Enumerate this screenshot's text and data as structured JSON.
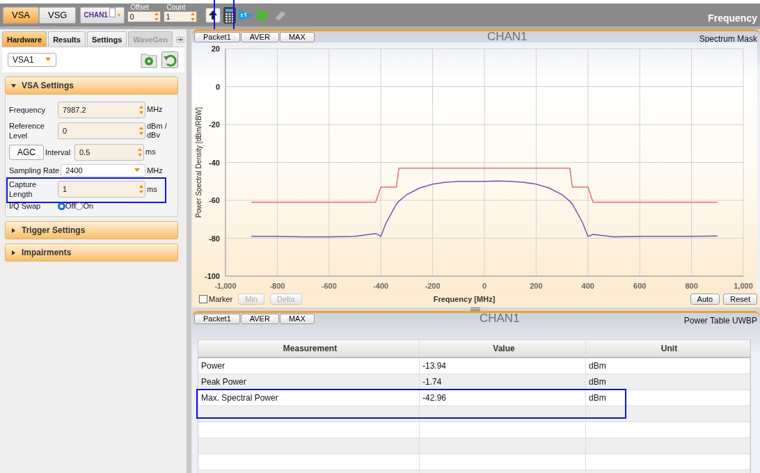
{
  "toolbar": {
    "modes": [
      {
        "label": "VSA",
        "selected": true
      },
      {
        "label": "VSG",
        "selected": false
      }
    ],
    "channel": "CHAN1",
    "spinners": [
      {
        "label": "Offset",
        "value": "0"
      },
      {
        "label": "Count",
        "value": "1"
      }
    ],
    "tools": [
      {
        "kind": "upload",
        "highlighted": false,
        "disabled": false
      },
      {
        "kind": "calculator",
        "highlighted": true,
        "disabled": false
      },
      {
        "kind": "run-once",
        "highlighted": false,
        "disabled": false
      },
      {
        "kind": "run",
        "highlighted": false,
        "disabled": false
      },
      {
        "kind": "eraser",
        "highlighted": false,
        "disabled": true
      }
    ],
    "title": "Frequency"
  },
  "sidebar": {
    "tabs": [
      {
        "label": "Hardware",
        "selected": true,
        "disabled": false
      },
      {
        "label": "Results",
        "selected": false,
        "disabled": false
      },
      {
        "label": "Settings",
        "selected": false,
        "disabled": false
      },
      {
        "label": "WaveGen",
        "selected": false,
        "disabled": true
      }
    ],
    "device": "VSA1",
    "sections": [
      {
        "title": "VSA Settings",
        "expanded": true,
        "fields": [
          {
            "kind": "spin",
            "label": "Frequency",
            "value": "7987.2",
            "unit": "MHz",
            "highlighted": false
          },
          {
            "kind": "spin",
            "label": "Reference Level",
            "value": "0",
            "unit": "dBm / dBv",
            "highlighted": false
          },
          {
            "kind": "agc",
            "button": "AGC",
            "label": "Interval",
            "value": "0.5",
            "unit": "ms",
            "highlighted": false
          },
          {
            "kind": "select",
            "label": "Sampling Rate",
            "value": "2400",
            "unit": "MHz",
            "highlighted": false
          },
          {
            "kind": "spin",
            "label": "Capture Length",
            "value": "1",
            "unit": "ms",
            "highlighted": true
          },
          {
            "kind": "radio",
            "label": "I/Q Swap",
            "options": [
              {
                "label": "Off",
                "selected": true
              },
              {
                "label": "On",
                "selected": false
              }
            ],
            "highlighted": false
          }
        ]
      },
      {
        "title": "Trigger Settings",
        "expanded": false
      },
      {
        "title": "Impairments",
        "expanded": false
      }
    ]
  },
  "spectrum_panel": {
    "views": [
      "Packet1",
      "AVER",
      "MAX"
    ],
    "channel": "CHAN1",
    "title": "Spectrum Mask",
    "chart_data": {
      "type": "line",
      "xlabel": "Frequency [MHz]",
      "ylabel": "Power Spectral Density [dBm/RBW]",
      "x": [
        -900,
        -800,
        -700,
        -600,
        -500,
        -420,
        -400,
        -380,
        -340,
        -330,
        -300,
        -250,
        -200,
        -150,
        -100,
        -50,
        0,
        50,
        100,
        150,
        200,
        250,
        300,
        330,
        340,
        380,
        400,
        420,
        500,
        600,
        700,
        800,
        900
      ],
      "series": [
        {
          "color": "#e07070",
          "values": [
            -61,
            -61,
            -61,
            -61,
            -61,
            -61,
            -53,
            -53,
            -53,
            -43,
            -43,
            -43,
            -43,
            -43,
            -43,
            -43,
            -43,
            -43,
            -43,
            -43,
            -43,
            -43,
            -43,
            -43,
            -53,
            -53,
            -53,
            -61,
            -61,
            -61,
            -61,
            -61,
            -61
          ]
        },
        {
          "color": "#7b4fb0",
          "values": [
            -79,
            -79,
            -79.3,
            -79.3,
            -79,
            -77.5,
            -79,
            -72,
            -62,
            -60.5,
            -57,
            -53.5,
            -51.5,
            -50.5,
            -50,
            -50,
            -50,
            -49.8,
            -50,
            -50.5,
            -51.5,
            -53.5,
            -57,
            -60.5,
            -62,
            -72,
            -79,
            -78,
            -79.3,
            -79,
            -79,
            -79,
            -78.8
          ]
        }
      ],
      "xlim": [
        -1000,
        1000
      ],
      "ylim": [
        -100,
        20
      ],
      "xticks": [
        {
          "value": -1000,
          "label": "-1,000"
        },
        -800,
        -600,
        -400,
        -200,
        0,
        200,
        400,
        600,
        800,
        {
          "value": 1000,
          "label": "1,000"
        }
      ],
      "yticks": [
        -100,
        -80,
        -60,
        -40,
        -20,
        0,
        20
      ],
      "grid": true
    },
    "controls": {
      "marker": {
        "label": "Marker",
        "checked": false
      },
      "buttons": [
        {
          "label": "Min",
          "disabled": true
        },
        {
          "label": "Delta",
          "disabled": true
        }
      ],
      "actions": [
        "Auto",
        "Reset"
      ]
    }
  },
  "power_panel": {
    "views": [
      "Packet1",
      "AVER",
      "MAX"
    ],
    "channel": "CHAN1",
    "title": "Power Table UWBP",
    "table": {
      "columns": [
        "Measurement",
        "Value",
        "Unit"
      ],
      "rows": [
        {
          "cells": [
            "Power",
            "-13.94",
            "dBm"
          ],
          "highlighted": false
        },
        {
          "cells": [
            "Peak Power",
            "-1.74",
            "dBm"
          ],
          "highlighted": false
        },
        {
          "cells": [
            "Max. Spectral Power",
            "-42.96",
            "dBm"
          ],
          "highlighted": true
        }
      ]
    }
  }
}
